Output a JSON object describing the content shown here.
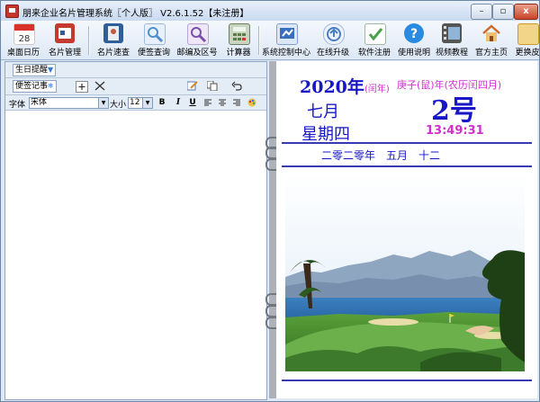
{
  "window": {
    "title": "朋来企业名片管理系统〖个人版〗 V2.6.1.52【未注册】",
    "min_icon": "minimize-icon",
    "max_icon": "maximize-icon",
    "close_icon": "close-icon",
    "min_glyph": "–",
    "max_glyph": "▫",
    "close_glyph": "x"
  },
  "toolbar": {
    "items": [
      {
        "label": "桌面日历",
        "icon": "calendar-icon",
        "color": "#d8322a"
      },
      {
        "label": "名片管理",
        "icon": "card-manage-icon",
        "color": "#c43a2e"
      },
      {
        "label": "名片速查",
        "icon": "address-book-icon",
        "color": "#2f5f9a"
      },
      {
        "label": "便签查询",
        "icon": "search-note-icon",
        "color": "#4f8fd0"
      },
      {
        "label": "邮编及区号",
        "icon": "postcode-icon",
        "color": "#7a4fb0"
      },
      {
        "label": "计算器",
        "icon": "calculator-icon",
        "color": "#5c7a4a"
      },
      {
        "label": "系统控制中心",
        "icon": "control-center-icon",
        "color": "#3a6fc0"
      },
      {
        "label": "在线升级",
        "icon": "online-upgrade-icon",
        "color": "#4a7ec8"
      },
      {
        "label": "软件注册",
        "icon": "register-icon",
        "color": "#4aa04a"
      },
      {
        "label": "使用说明",
        "icon": "help-icon",
        "color": "#2a8ae0"
      },
      {
        "label": "视频教程",
        "icon": "video-icon",
        "color": "#555555"
      },
      {
        "label": "官方主页",
        "icon": "home-icon",
        "color": "#d06a2a"
      },
      {
        "label": "更换皮",
        "icon": "skin-icon",
        "color": "#c89a2a"
      }
    ]
  },
  "left_panel": {
    "birthday_tab": "生日提醒",
    "memo_tab": "便签记事",
    "font_label": "字体",
    "font_value": "宋体",
    "size_label": "大小",
    "size_value": "12",
    "bold": "B",
    "italic": "I",
    "underline": "U"
  },
  "calendar": {
    "year": "2020年",
    "leap_note": "(闰年)",
    "ganzhi": "庚子(鼠)年(农历闰四月)",
    "month": "七月",
    "day": "2号",
    "weekday": "星期四",
    "time": "13:49:31",
    "lunar_date": "二零二零年　五月　十二"
  },
  "colors": {
    "accent_blue": "#1717c8",
    "accent_magenta": "#d02fd0"
  }
}
